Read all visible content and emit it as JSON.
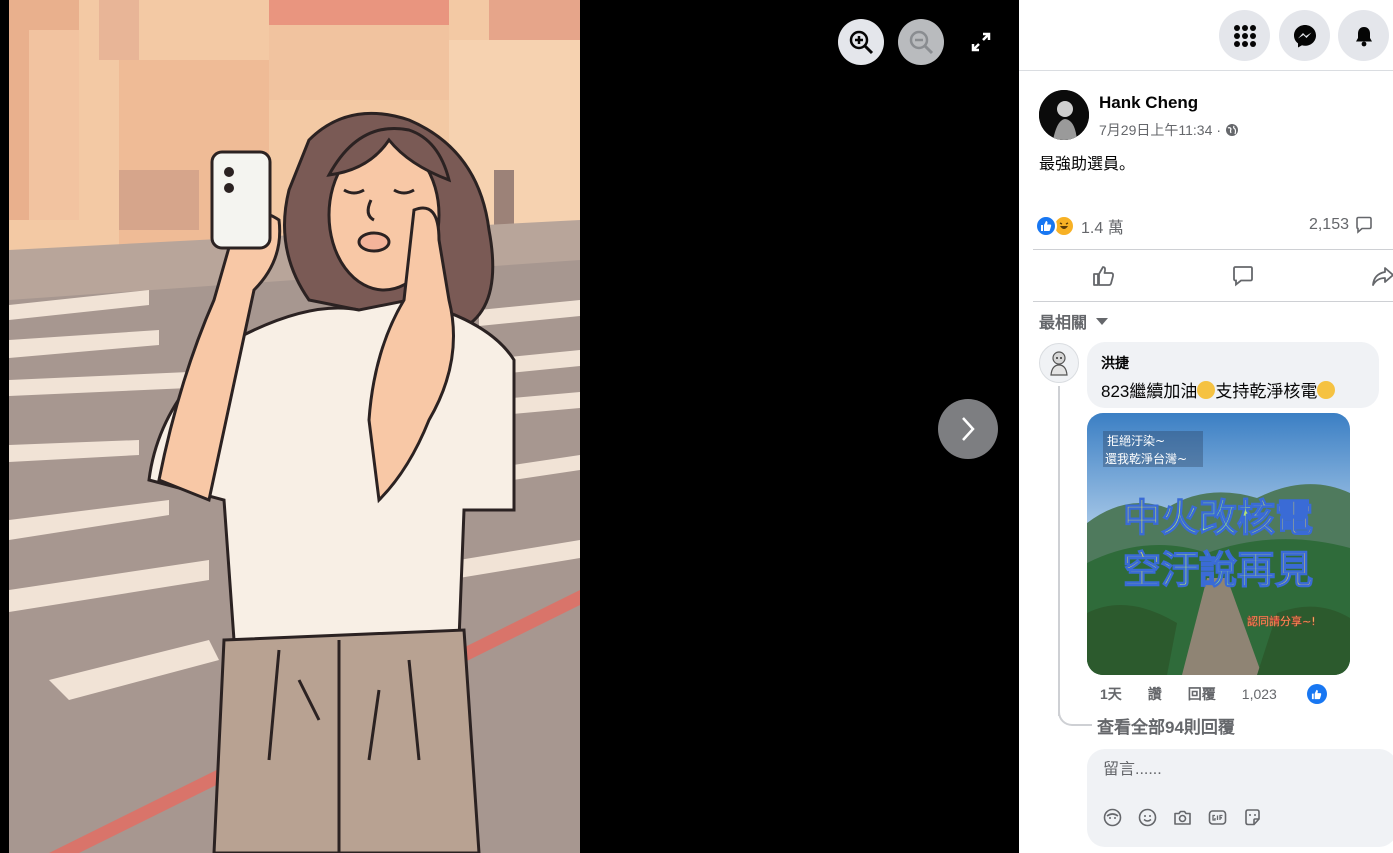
{
  "viewer": {
    "controls": {
      "zoom_in_icon": "zoom-in-icon",
      "zoom_out_icon": "zoom-out-icon",
      "fullscreen_icon": "fullscreen-icon",
      "next_icon": "chevron-right-icon"
    }
  },
  "topbar": {
    "icons": [
      "menu-grid-icon",
      "messenger-icon",
      "notifications-bell-icon"
    ]
  },
  "post": {
    "author": "Hank Cheng",
    "timestamp": "7月29日上午11:34",
    "separator": "·",
    "audience_icon": "globe-icon",
    "text": "最強助選員。",
    "reaction_count": "1.4 萬",
    "comment_count": "2,153"
  },
  "colors": {
    "accent": "#1877f2",
    "secondary_text": "#65676b",
    "bubble_bg": "#f0f2f5"
  },
  "comments": {
    "sort_label": "最相關",
    "top_comment": {
      "author": "洪捷",
      "text_part1": "823繼續加油",
      "text_part2": "支持乾淨核電",
      "image_text": {
        "line_top1": "拒絕汙染~",
        "line_top2": "還我乾淨台灣~",
        "line_main1": "中火改核電",
        "line_main2": "空汙說再見",
        "line_bottom": "認同請分享~!"
      },
      "age": "1天",
      "like_action": "讚",
      "reply_action": "回覆",
      "like_count": "1,023"
    },
    "view_replies": "查看全部94則回覆",
    "composer_placeholder": "留言......"
  }
}
